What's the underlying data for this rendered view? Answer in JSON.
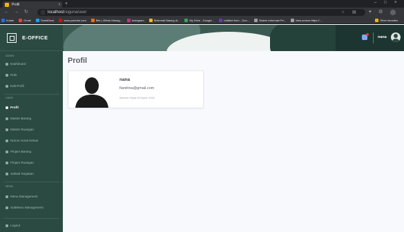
{
  "browser": {
    "tab_title": "Profil",
    "tab_close": "×",
    "new_tab": "+",
    "window_controls": [
      "–",
      "□",
      "×"
    ],
    "url_host": "localhost",
    "url_path": "/siguna/user",
    "bookmarks": [
      {
        "label": "Kuliah",
        "color": "#1a73e8"
      },
      {
        "label": "Gmail",
        "color": "#ea4335"
      },
      {
        "label": "TweetDeck",
        "color": "#1da1f2"
      },
      {
        "label": "www.youtube.com",
        "color": "#ff0000"
      },
      {
        "label": "Bits | 4Work Manag...",
        "color": "#ff6d00"
      },
      {
        "label": "Instagram",
        "color": "#c13584"
      },
      {
        "label": "Sistemati Balang di...",
        "color": "#fbbc04"
      },
      {
        "label": "My Drive - Google...",
        "color": "#34a853"
      },
      {
        "label": "Untitled form - Goo...",
        "color": "#673ab7"
      },
      {
        "label": "Sistem Informasi Pe...",
        "color": "#9aa0a6"
      },
      {
        "label": "view-source:https://...",
        "color": "#9aa0a6"
      }
    ],
    "other_bookmarks": "Other favorites"
  },
  "app": {
    "brand": "E-OFFICE",
    "sidebar": {
      "section_admin": "ADMIN",
      "section_user": "USER",
      "section_menu": "MENU",
      "admin_items": [
        {
          "label": "Dashboard"
        },
        {
          "label": "Role"
        },
        {
          "label": "Edit Profil"
        }
      ],
      "user_items": [
        {
          "label": "Profil",
          "active": true
        },
        {
          "label": "Master Barang"
        },
        {
          "label": "Master Ruangan"
        },
        {
          "label": "Nomor Surat Keluar"
        },
        {
          "label": "Pinjam Barang"
        },
        {
          "label": "Pinjam Ruangan"
        },
        {
          "label": "Jadwal Kegiatan"
        }
      ],
      "menu_items": [
        {
          "label": "Menu Management"
        },
        {
          "label": "SubMenu Management"
        }
      ],
      "logout": "Logout"
    },
    "topbar": {
      "username": "nana"
    },
    "page_title": "Profil",
    "profile": {
      "name": "nana",
      "email": "fiantrina@gmail.com",
      "member_since": "Member Sejak 30 March 2020"
    }
  }
}
